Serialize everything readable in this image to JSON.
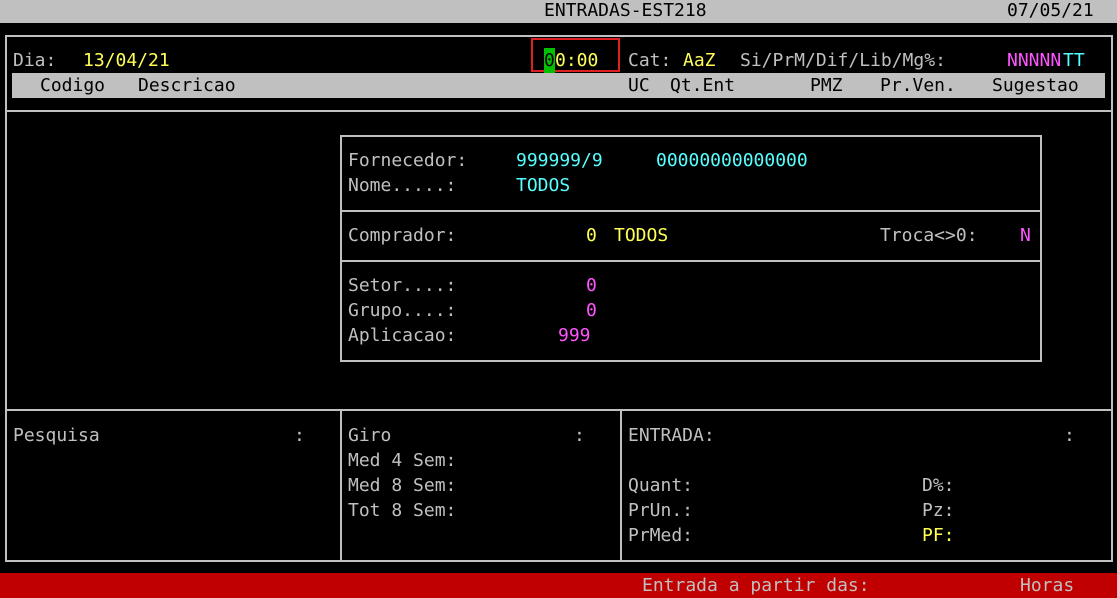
{
  "titlebar": {
    "title": "ENTRADAS-EST218",
    "date": "07/05/21"
  },
  "top": {
    "dia_label": "Dia:",
    "dia_value": "13/04/21",
    "time_first": "0",
    "time_rest": "0:00",
    "cat_label": "Cat:",
    "cat_value": "AaZ",
    "flags_label": "Si/PrM/Dif/Lib/Mg%:",
    "flags_magenta": "NNNNN",
    "flags_cyan": "TT"
  },
  "columns": {
    "codigo": "Codigo",
    "descricao": "Descricao",
    "uc": "UC",
    "qt_ent": "Qt.Ent",
    "pmz": "PMZ",
    "pr_ven": "Pr.Ven.",
    "sugestao": "Sugestao"
  },
  "dialog": {
    "fornecedor_label": "Fornecedor:",
    "fornecedor_code": "999999/9",
    "fornecedor_doc": "00000000000000",
    "nome_label": "Nome.....:",
    "nome_value": "TODOS",
    "comprador_label": "Comprador:",
    "comprador_code": "0",
    "comprador_value": "TODOS",
    "troca_label": "Troca<>0:",
    "troca_value": "N",
    "setor_label": "Setor....:",
    "setor_value": "0",
    "grupo_label": "Grupo....:",
    "grupo_value": "0",
    "aplicacao_label": "Aplicacao:",
    "aplicacao_value": "999"
  },
  "bottom": {
    "pesquisa_label": "Pesquisa",
    "pesquisa_colon": ":",
    "giro_label": "Giro",
    "giro_colon": ":",
    "med4": "Med 4 Sem:",
    "med8": "Med 8 Sem:",
    "tot8": "Tot 8 Sem:",
    "entrada_label": "ENTRADA:",
    "entrada_colon": ":",
    "quant": "Quant:",
    "prun": "PrUn.:",
    "prmed": "PrMed:",
    "d_pct": "D%:",
    "pz": "Pz:",
    "pf": "PF:"
  },
  "status": {
    "prompt": "Entrada a partir das:",
    "unit": "Horas"
  },
  "colors": {
    "background": "#000000",
    "text": "#c0c0c0",
    "yellow": "#ffff55",
    "cyan": "#55ffff",
    "magenta": "#ff55ff",
    "cursor": "#00c000",
    "statusbar": "#c00000",
    "highlight_border": "#e02020"
  }
}
